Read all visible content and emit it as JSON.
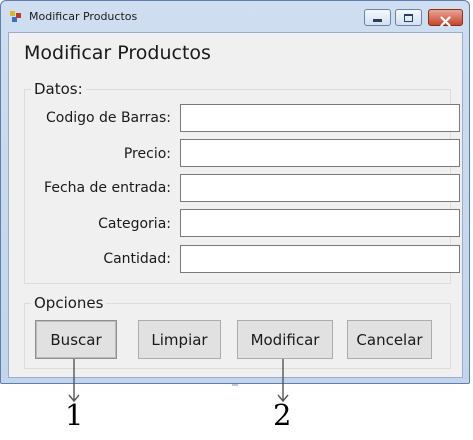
{
  "window": {
    "title": "Modificar Productos",
    "controls": [
      "minimize-icon",
      "maximize-icon",
      "close-icon"
    ]
  },
  "form": {
    "heading": "Modificar Productos",
    "datos": {
      "legend": "Datos:",
      "fields": [
        {
          "label": "Codigo de Barras:",
          "value": ""
        },
        {
          "label": "Precio:",
          "value": ""
        },
        {
          "label": "Fecha de entrada:",
          "value": ""
        },
        {
          "label": "Categoria:",
          "value": ""
        },
        {
          "label": "Cantidad:",
          "value": ""
        }
      ]
    },
    "opciones": {
      "legend": "Opciones",
      "buttons": {
        "buscar": "Buscar",
        "limpiar": "Limpiar",
        "modificar": "Modificar",
        "cancelar": "Cancelar"
      }
    }
  },
  "annotations": {
    "one": "1",
    "two": "2"
  },
  "colors": {
    "frame": "#c2d5ec",
    "client": "#f0f0f0",
    "button": "#e1e1e1",
    "close_button": "#c4462d"
  }
}
